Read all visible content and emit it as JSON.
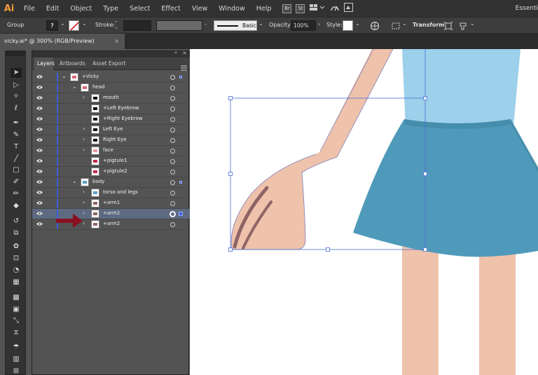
{
  "menubar": {
    "logo": "Ai",
    "items": [
      "File",
      "Edit",
      "Object",
      "Type",
      "Select",
      "Effect",
      "View",
      "Window",
      "Help"
    ],
    "icons": [
      "Br",
      "St"
    ],
    "workspace": "Essenti"
  },
  "control": {
    "selection_type": "Group",
    "fill_label": "?",
    "stroke_label": "Stroke:",
    "brush_label": "Basic",
    "opacity_label": "Opacity:",
    "opacity_value": "100%",
    "style_label": "Style:",
    "transform_label": "Transform"
  },
  "document": {
    "tab_title": "vicky.ai* @ 300% (RGB/Preview)",
    "close": "×"
  },
  "panel": {
    "tabs": [
      "Layers",
      "Artboards",
      "Asset Export"
    ],
    "layers": [
      {
        "name": "+Vicky",
        "indent": 0,
        "expanded": true,
        "selected": false
      },
      {
        "name": "head",
        "indent": 1,
        "expanded": true,
        "selected": false
      },
      {
        "name": "mouth",
        "indent": 2,
        "expanded": false,
        "selected": false
      },
      {
        "name": "+Left Eyebrow",
        "indent": 2,
        "expanded": null,
        "selected": false
      },
      {
        "name": "+Right Eyebrow",
        "indent": 2,
        "expanded": null,
        "selected": false
      },
      {
        "name": "Left Eye",
        "indent": 2,
        "expanded": false,
        "selected": false
      },
      {
        "name": "Right Eye",
        "indent": 2,
        "expanded": false,
        "selected": false
      },
      {
        "name": "face",
        "indent": 2,
        "expanded": false,
        "selected": false
      },
      {
        "name": "+pigtule1",
        "indent": 2,
        "expanded": null,
        "selected": false
      },
      {
        "name": "+pigtule2",
        "indent": 2,
        "expanded": null,
        "selected": false
      },
      {
        "name": "body",
        "indent": 1,
        "expanded": true,
        "selected": false
      },
      {
        "name": "torso and legs",
        "indent": 2,
        "expanded": false,
        "selected": false
      },
      {
        "name": "+arm1",
        "indent": 2,
        "expanded": false,
        "selected": false
      },
      {
        "name": "+arm2",
        "indent": 2,
        "expanded": false,
        "selected": true
      },
      {
        "name": "+arm2",
        "indent": 2,
        "expanded": false,
        "selected": false
      }
    ]
  },
  "colors": {
    "accent": "#3a5fd9",
    "skin": "#efc2ab",
    "shirt": "#9dd0ea",
    "skirt": "#4f9aba",
    "nail": "#8e6565",
    "arrow": "#8a1020"
  }
}
